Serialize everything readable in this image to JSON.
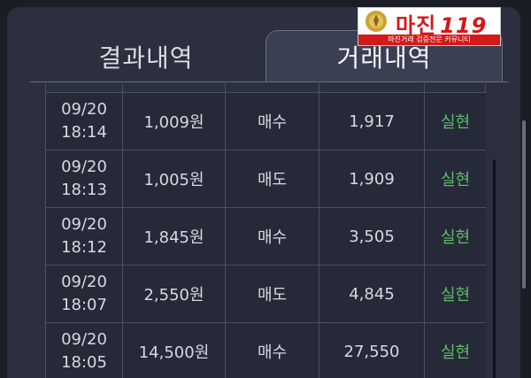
{
  "tabs": [
    {
      "label": "결과내역",
      "active": false
    },
    {
      "label": "거래내역",
      "active": true
    }
  ],
  "logo": {
    "text": "마진",
    "number": "119",
    "subtitle": "마진거래 검증전문 커뮤니티"
  },
  "rows": [
    {
      "date": "09/20",
      "time": "18:14",
      "amount": "1,009원",
      "type": "매수",
      "price": "1,917",
      "status": "실현"
    },
    {
      "date": "09/20",
      "time": "18:13",
      "amount": "1,005원",
      "type": "매도",
      "price": "1,909",
      "status": "실현"
    },
    {
      "date": "09/20",
      "time": "18:12",
      "amount": "1,845원",
      "type": "매수",
      "price": "3,505",
      "status": "실현"
    },
    {
      "date": "09/20",
      "time": "18:07",
      "amount": "2,550원",
      "type": "매도",
      "price": "4,845",
      "status": "실현"
    },
    {
      "date": "09/20",
      "time": "18:05",
      "amount": "14,500원",
      "type": "매수",
      "price": "27,550",
      "status": "실현"
    }
  ],
  "colors": {
    "background": "#1b1d26",
    "panel": "#2b2f3e",
    "active_tab": "#3a3f52",
    "status_green": "#5fba6a",
    "logo_red": "#d21a1a"
  }
}
